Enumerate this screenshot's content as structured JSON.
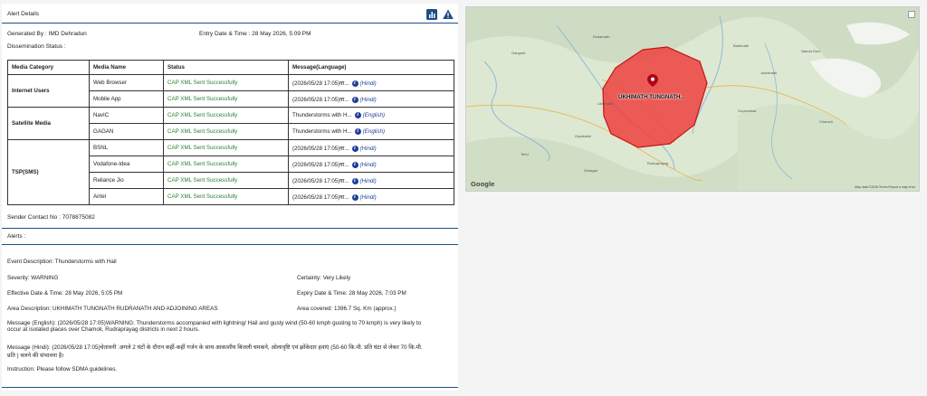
{
  "panel": {
    "title": "Alert Details",
    "generated_by": "Generated By : IMD Dehradun",
    "entry_datetime": "Entry Date & Time : 28 May 2026, 5:09 PM",
    "dissemination_status": "Dissemination Status :"
  },
  "table": {
    "headers": [
      "Media Category",
      "Media Name",
      "Status",
      "Message(Language)"
    ],
    "categories": [
      "Internet Users",
      "Satellite Media",
      "TSP(SMS)"
    ],
    "rows": [
      {
        "name": "Web Browser",
        "status": "CAP XML Sent Successfully",
        "message": "(2026/05/28 17:05)वा...",
        "lang": "(Hindi)"
      },
      {
        "name": "Mobile App",
        "status": "CAP XML Sent Successfully",
        "message": "(2026/05/28 17:05)वा...",
        "lang": "(Hindi)"
      },
      {
        "name": "NavIC",
        "status": "CAP XML Sent Successfully",
        "message": "Thunderstorms with H...",
        "lang": "(English)"
      },
      {
        "name": "GAGAN",
        "status": "CAP XML Sent Successfully",
        "message": "Thunderstorms with H...",
        "lang": "(English)"
      },
      {
        "name": "BSNL",
        "status": "CAP XML Sent Successfully",
        "message": "(2026/05/28 17:05)वा...",
        "lang": "(Hindi)"
      },
      {
        "name": "Vodafone-Idea",
        "status": "CAP XML Sent Successfully",
        "message": "(2026/05/28 17:05)वा...",
        "lang": "(Hindi)"
      },
      {
        "name": "Reliance Jio",
        "status": "CAP XML Sent Successfully",
        "message": "(2026/05/28 17:05)वा...",
        "lang": "(Hindi)"
      },
      {
        "name": "Airtel",
        "status": "CAP XML Sent Successfully",
        "message": "(2026/05/28 17:05)वा...",
        "lang": "(Hindi)"
      }
    ]
  },
  "sender_contact": "Sender Contact No : 7078875082",
  "alerts_label": "Alerts :",
  "details": {
    "event_description": "Event Description: Thunderstorms with Hail",
    "severity": "Severity: WARNING",
    "certainty": "Certainty: Very Likely",
    "effective": "Effective Date & Time: 28 May 2026, 5:05 PM",
    "expiry": "Expiry Date & Time: 28 May 2026, 7:03 PM",
    "area_description": "Area Description: UKHIMATH TUNGNATH RUDRANATH AND ADJOINING AREAS",
    "area_covered": "Area covered: 1396.7 Sq. Km (approx.)",
    "message_english_1": "Message (English): (2026/05/28 17:05)WARNING: Thunderstorms accompanied with lightning/ Hail and gusty wind (50-60 kmph gusting to 70 kmph) is very likely to",
    "message_english_2": "occur at isolated places over Chamoli, Rudraprayag districts in next 2 hours.",
    "message_hindi_1": "Message (Hindi): (2026/05/28 17:05)चेतावनी :अगले 2 घंटों के दौरान कहीं-कहीं गर्जन के साथ आकाशीय बिजली चमकने, ओलावृष्टि एवं झोंकेदार हवाएं (50-60 कि.मी. प्रति घंटा से लेकर 70 कि.मी.",
    "message_hindi_2": "प्रति ) चलने की संभावना है।",
    "instruction": "Instruction: Please follow SDMA guidelines."
  },
  "map": {
    "area_label": "UKHIMATH TUNGNATH...",
    "google": "Google",
    "footer": "Map data ©2026   Terms   Report a map error",
    "alert_fill": "#ef3b3b",
    "towns": [
      "Gangotri",
      "Kedarnath",
      "Ukhimath",
      "Gopeshwar",
      "Joshimath",
      "Nanda Devi",
      "Chamoli",
      "Rudraprayag",
      "Tehri",
      "Srinagar",
      "Guptkashi",
      "Badrinath"
    ]
  },
  "icons": {
    "chart": "chart-icon",
    "warning": "warning-icon",
    "info": "info-icon",
    "marker": "map-marker-icon"
  }
}
